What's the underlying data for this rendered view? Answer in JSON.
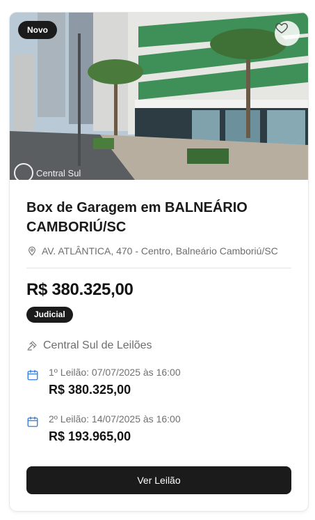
{
  "listing": {
    "badge": "Novo",
    "photo_watermark": "Central Sul",
    "title": "Box de Garagem em BALNEÁRIO CAMBORIÚ/SC",
    "address": "AV. ATLÂNTICA, 470 - Centro, Balneário Camboriú/SC",
    "price": "R$ 380.325,00",
    "type_tag": "Judicial",
    "auctioneer": "Central Sul de Leilões",
    "rounds": [
      {
        "label": "1º Leilão: 07/07/2025 às 16:00",
        "value": "R$ 380.325,00"
      },
      {
        "label": "2º Leilão: 14/07/2025 às 16:00",
        "value": "R$ 193.965,00"
      }
    ],
    "cta": "Ver Leilão"
  },
  "icons": {
    "favorite": "heart-outline-icon",
    "location": "map-pin-icon",
    "auctioneer": "gavel-icon",
    "date": "calendar-icon"
  },
  "colors": {
    "dark": "#1b1b1b",
    "muted_text": "#6e6e6e",
    "calendar_accent": "#2f7ce0"
  }
}
